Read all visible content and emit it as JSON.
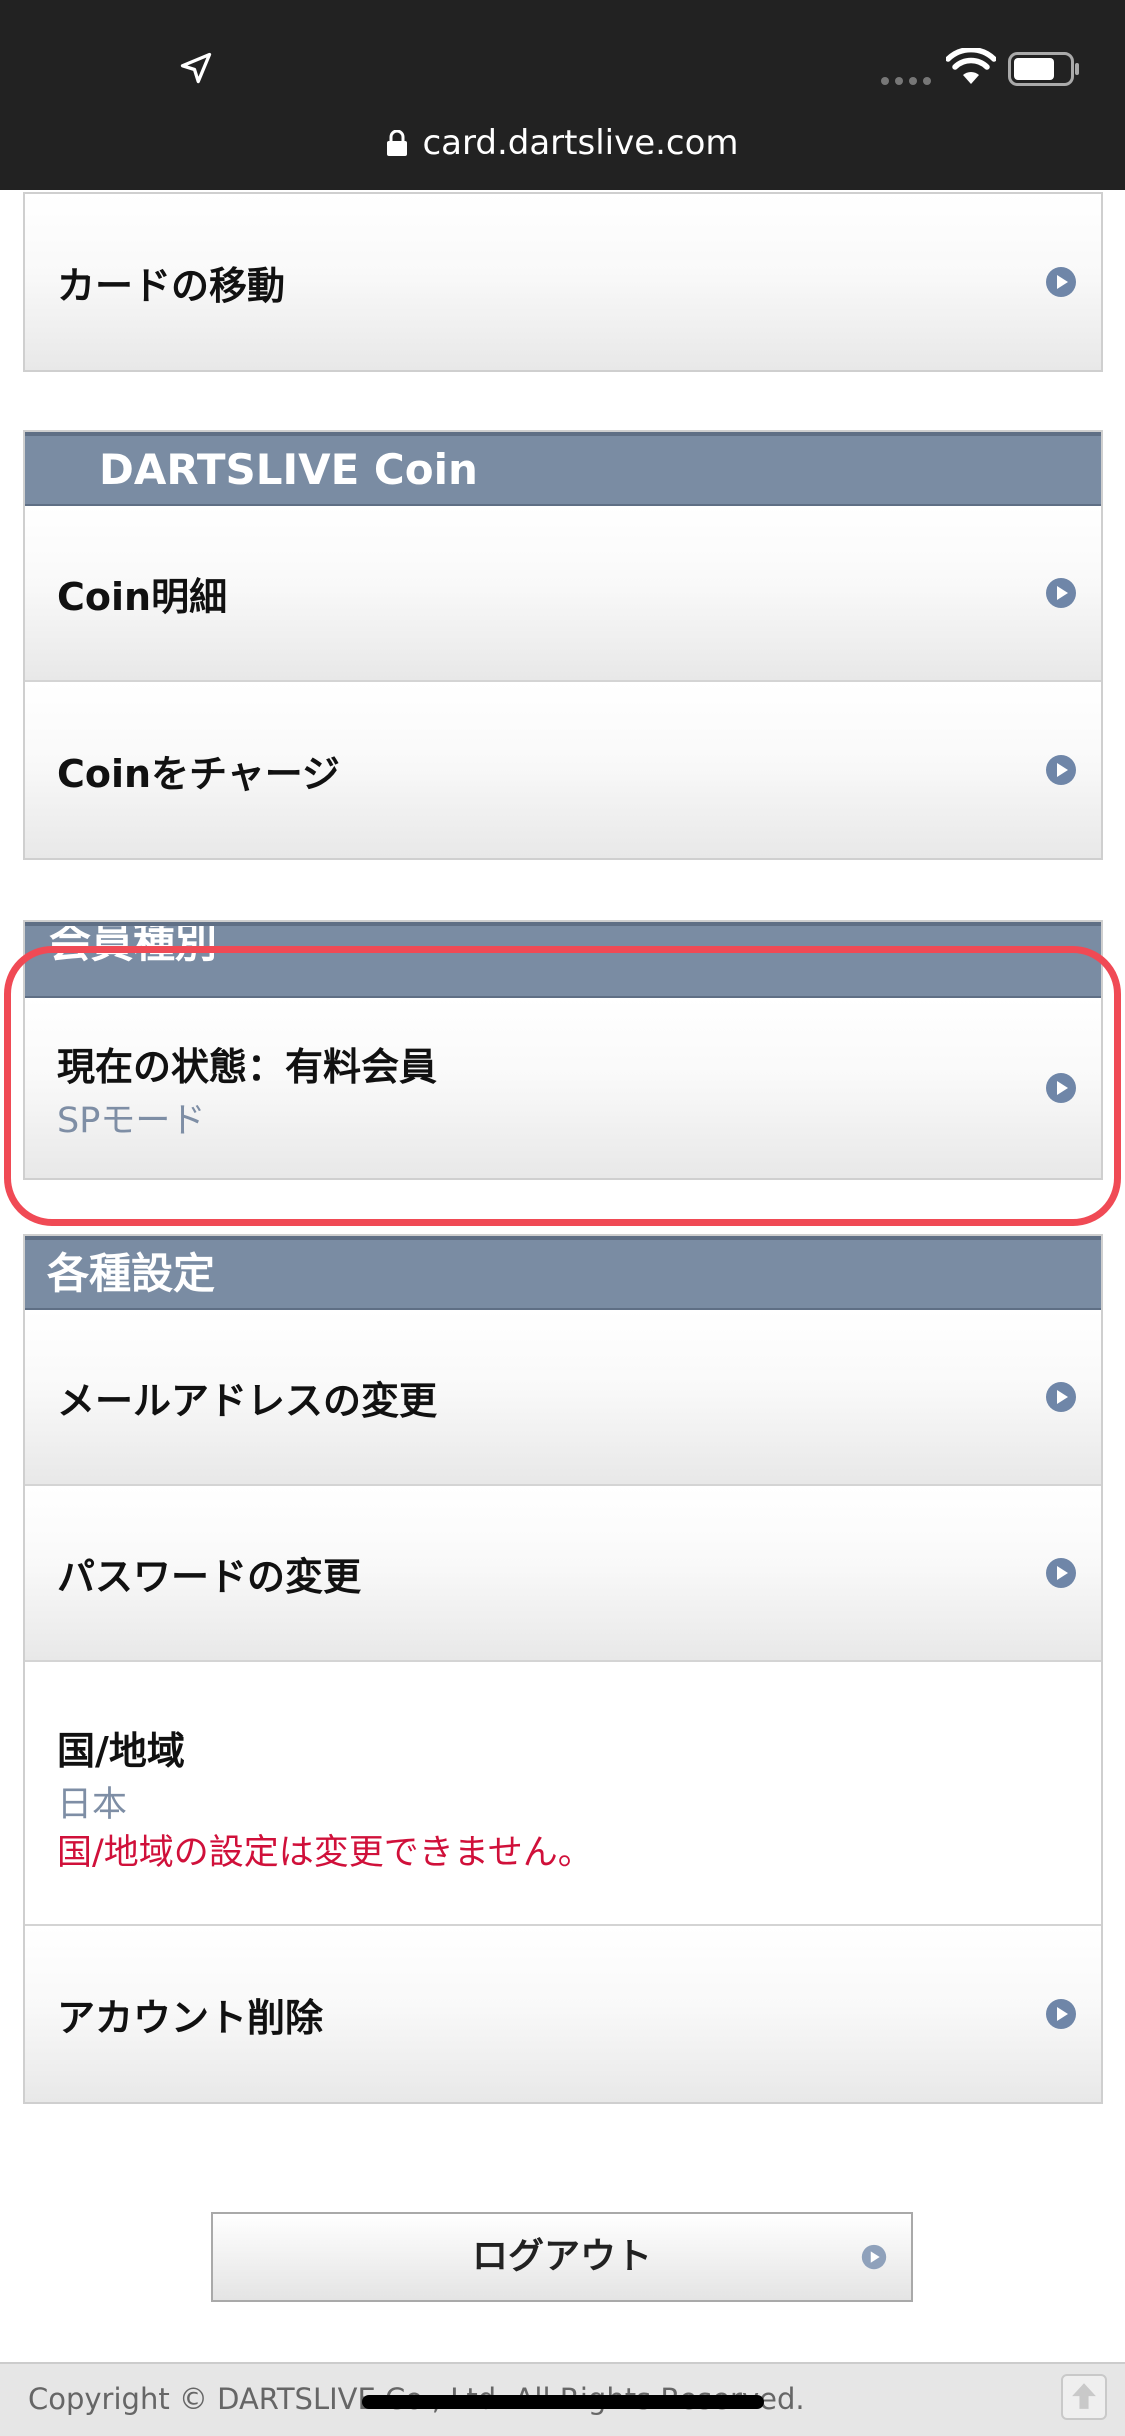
{
  "browser": {
    "url": "card.dartslive.com"
  },
  "menu_top": {
    "card_move": "カードの移動"
  },
  "coin_section": {
    "title": "DARTSLIVE Coin",
    "items": [
      "Coin明細",
      "Coinをチャージ"
    ]
  },
  "membership": {
    "title": "会員種別",
    "status": "現在の状態：有料会員",
    "mode": "SPモード"
  },
  "settings": {
    "title": "各種設定",
    "change_email": "メールアドレスの変更",
    "change_password": "パスワードの変更",
    "region_label": "国/地域",
    "region_value": "日本",
    "region_note": "国/地域の設定は変更できません。",
    "delete_account": "アカウント削除"
  },
  "logout_label": "ログアウト",
  "footer": {
    "copyright": "Copyright © DARTSLIVE Co., Ltd. All Rights Reserved."
  },
  "colors": {
    "section_header": "#7a8ca3",
    "highlight_ring": "#f04a55",
    "sub_text": "#7e8ea5",
    "warning_text": "#d0103a",
    "arrow": "#6f86a8"
  }
}
